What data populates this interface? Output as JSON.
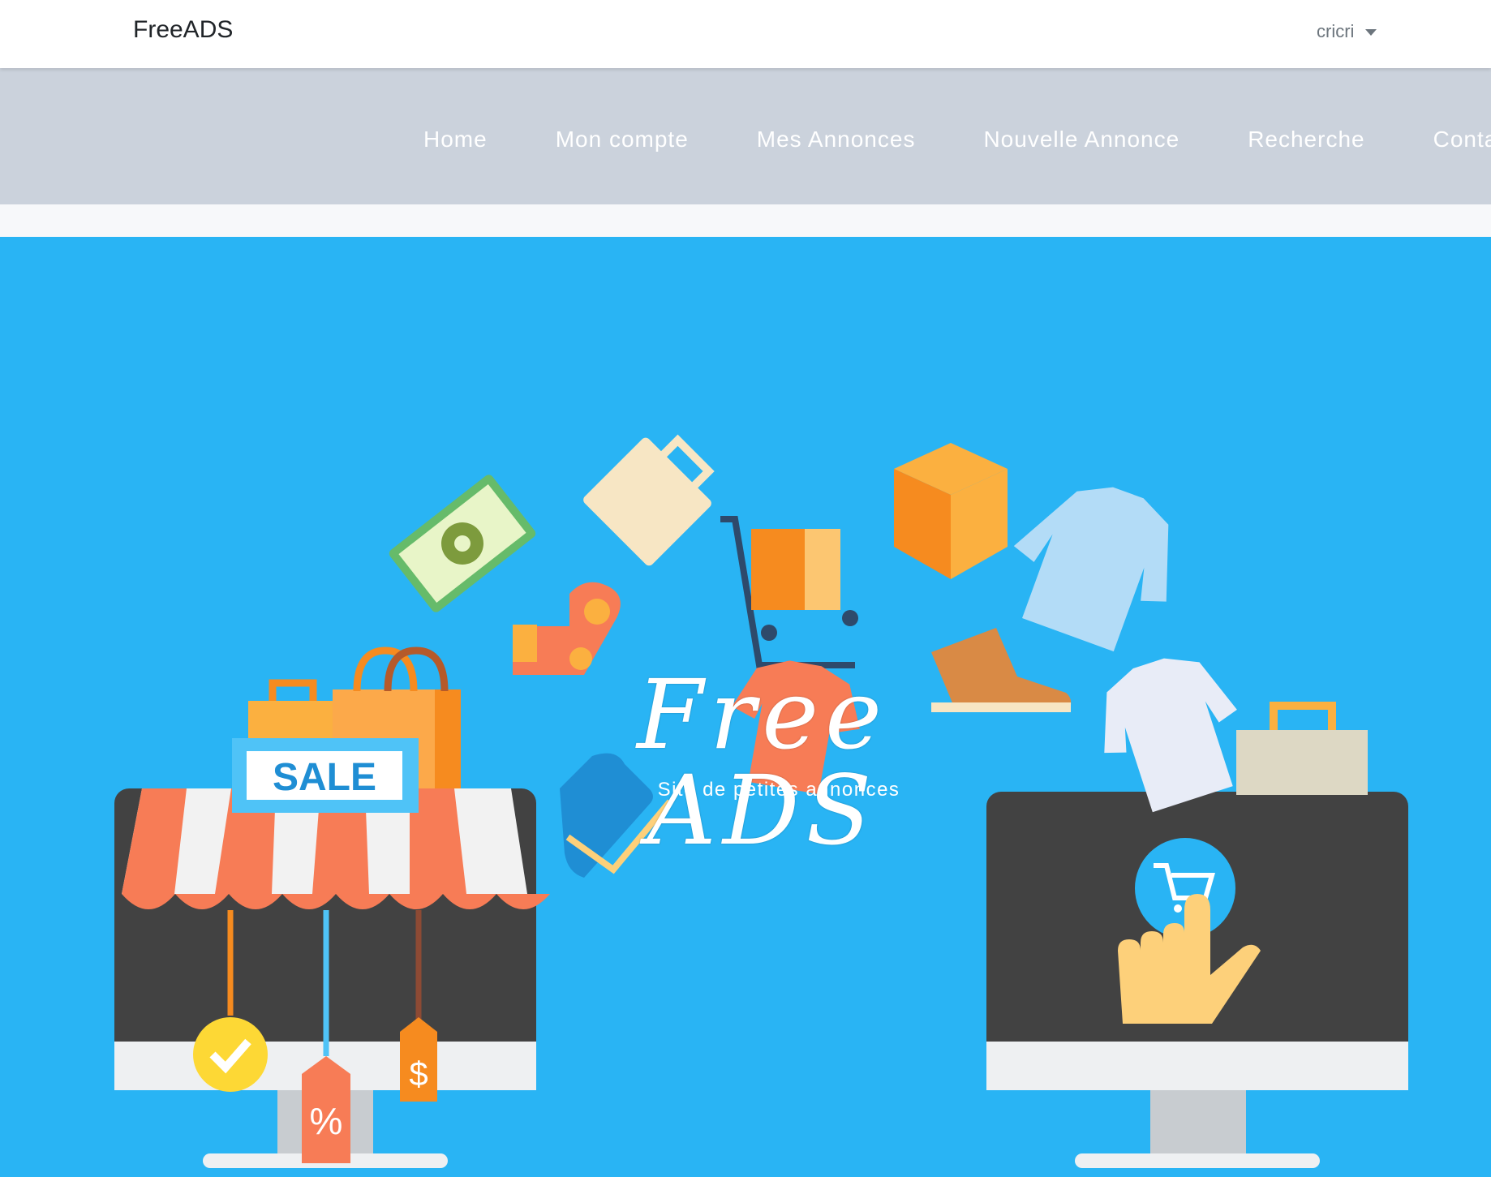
{
  "header": {
    "brand": "FreeADS",
    "user": "cricri"
  },
  "nav": {
    "items": [
      "Home",
      "Mon compte",
      "Mes Annonces",
      "Nouvelle Annonce",
      "Recherche",
      "Contact"
    ]
  },
  "hero": {
    "title": "Free ADS",
    "subtitle": "Site de petites annonces",
    "sale_label": "SALE",
    "percent_label": "%",
    "dollar_label": "$"
  },
  "colors": {
    "hero_bg": "#29b4f4",
    "nav_bg": "#cbd2dc",
    "topbar_bg": "#ffffff"
  }
}
